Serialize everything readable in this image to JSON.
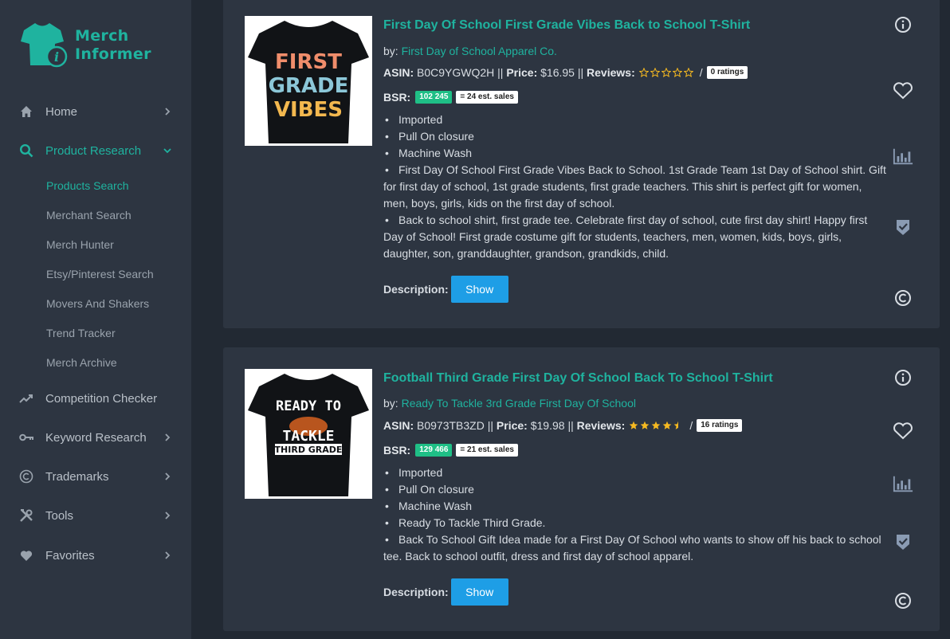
{
  "brand": {
    "name_line1": "Merch",
    "name_line2": "Informer",
    "color": "#1fb39f"
  },
  "sidebar": {
    "items": [
      {
        "label": "Home",
        "icon": "home-icon",
        "has_chevron": true
      },
      {
        "label": "Product Research",
        "icon": "search-icon",
        "has_chevron": true,
        "expanded": true
      },
      {
        "label": "Competition Checker",
        "icon": "trending-icon",
        "has_chevron": false
      },
      {
        "label": "Keyword Research",
        "icon": "key-icon",
        "has_chevron": true
      },
      {
        "label": "Trademarks",
        "icon": "copyright-icon",
        "has_chevron": true
      },
      {
        "label": "Tools",
        "icon": "tools-icon",
        "has_chevron": true
      },
      {
        "label": "Favorites",
        "icon": "heart-icon",
        "has_chevron": true
      }
    ],
    "subitems": [
      {
        "label": "Products Search",
        "active": true
      },
      {
        "label": "Merchant Search"
      },
      {
        "label": "Merch Hunter"
      },
      {
        "label": "Etsy/Pinterest Search"
      },
      {
        "label": "Movers And Shakers"
      },
      {
        "label": "Trend Tracker"
      },
      {
        "label": "Merch Archive"
      }
    ]
  },
  "products": [
    {
      "title": "First Day Of School First Grade Vibes Back to School T-Shirt",
      "by_label": "by:",
      "brand": "First Day of School Apparel Co.",
      "asin_label": "ASIN:",
      "asin": "B0C9YGWQ2H",
      "price_label": "Price:",
      "price": "$16.95",
      "reviews_label": "Reviews:",
      "rating_value": 0,
      "ratings_count": "0 ratings",
      "bsr_label": "BSR:",
      "bsr": "102 245",
      "est_sales": "= 24 est. sales",
      "shirt_text": [
        "FIRST",
        "GRADE",
        "VIBES"
      ],
      "bullets": [
        "Imported",
        "Pull On closure",
        "Machine Wash",
        "First Day Of School First Grade Vibes Back to School. 1st Grade Team 1st Day of School shirt. Gift for first day of school, 1st grade students, first grade teachers. This shirt is perfect gift for women, men, boys, girls, kids on the first day of school.",
        "Back to school shirt, first grade tee. Celebrate first day of school, cute first day shirt! Happy first Day of School! First grade costume gift for students, teachers, men, women, kids, boys, girls, daughter, son, granddaughter, grandson, grandkids, child."
      ],
      "description_label": "Description:",
      "show_label": "Show"
    },
    {
      "title": "Football Third Grade First Day Of School Back To School T-Shirt",
      "by_label": "by:",
      "brand": "Ready To Tackle 3rd Grade First Day Of School",
      "asin_label": "ASIN:",
      "asin": "B0973TB3ZD",
      "price_label": "Price:",
      "price": "$19.98",
      "reviews_label": "Reviews:",
      "rating_value": 4.5,
      "ratings_count": "16 ratings",
      "bsr_label": "BSR:",
      "bsr": "129 466",
      "est_sales": "= 21 est. sales",
      "shirt_text": [
        "READY TO",
        "TACKLE",
        "THIRD GRADE"
      ],
      "bullets": [
        "Imported",
        "Pull On closure",
        "Machine Wash",
        "Ready To Tackle Third Grade.",
        "Back To School Gift Idea made for a First Day Of School who wants to show off his back to school tee. Back to school outfit, dress and first day of school apparel."
      ],
      "description_label": "Description:",
      "show_label": "Show"
    }
  ],
  "separator": "||",
  "ratings_slash": "/"
}
